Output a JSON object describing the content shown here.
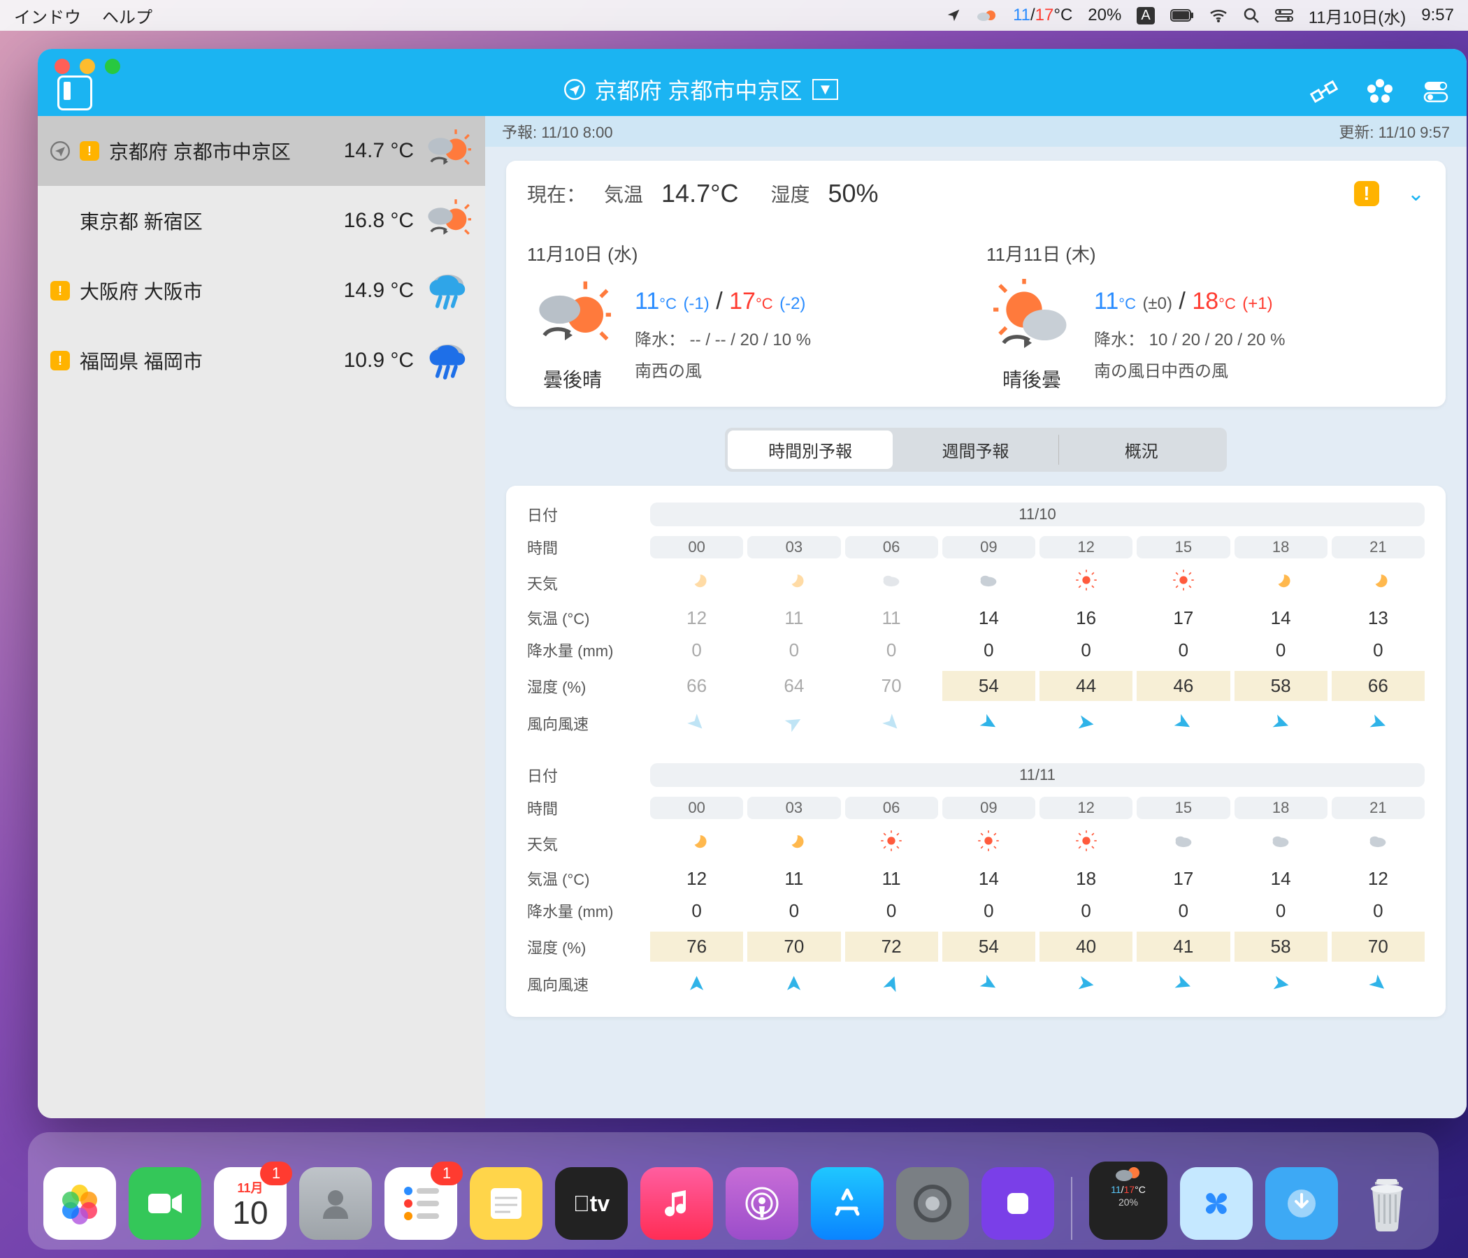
{
  "menubar": {
    "menus": [
      "インドウ",
      "ヘルプ"
    ],
    "temp_low": "11",
    "temp_high": "17",
    "temp_unit": "°C",
    "battery_pct": "20%",
    "ime": "A",
    "date": "11月10日(水)",
    "time": "9:57"
  },
  "titlebar": {
    "location": "京都府 京都市中京区"
  },
  "infobar": {
    "forecast": "予報: 11/10 8:00",
    "updated": "更新: 11/10 9:57"
  },
  "current": {
    "label_now": "現在：",
    "label_temp": "気温",
    "temp": "14.7°C",
    "label_hum": "湿度",
    "hum": "50%"
  },
  "sidebar": [
    {
      "name": "京都府 京都市中京区",
      "temp": "14.7 °C",
      "sel": true,
      "loc": true,
      "warn": true,
      "icon": "cloudy-then-sun"
    },
    {
      "name": "東京都 新宿区",
      "temp": "16.8 °C",
      "icon": "cloudy-then-sun"
    },
    {
      "name": "大阪府 大阪市",
      "temp": "14.9 °C",
      "warn": true,
      "icon": "rain"
    },
    {
      "name": "福岡県 福岡市",
      "temp": "10.9 °C",
      "warn": true,
      "icon": "rain-heavy"
    }
  ],
  "days": [
    {
      "header": "11月10日 (水)",
      "caption": "曇後晴",
      "low": "11",
      "low_d": "(-1)",
      "high": "17",
      "high_d": "(-2)",
      "precip": "降水：  -- / -- / 20 / 10 %",
      "wind": "南西の風",
      "icon": "cloudy-then-sun"
    },
    {
      "header": "11月11日 (木)",
      "caption": "晴後曇",
      "low": "11",
      "low_d": "(±0)",
      "high": "18",
      "high_d": "(+1)",
      "precip": "降水：  10 / 20 / 20 / 20 %",
      "wind": "南の風日中西の風",
      "icon": "sun-then-cloudy"
    }
  ],
  "seg": {
    "hourly": "時間別予報",
    "weekly": "週間予報",
    "overview": "概況"
  },
  "hourly_labels": {
    "date": "日付",
    "time": "時間",
    "weather": "天気",
    "temp": "気温 (°C)",
    "precip": "降水量 (mm)",
    "hum": "湿度 (%)",
    "wind": "風向風速"
  },
  "hourly": [
    {
      "date": "11/10",
      "hours": [
        "00",
        "03",
        "06",
        "09",
        "12",
        "15",
        "18",
        "21"
      ],
      "weather": [
        "moon",
        "moon",
        "cloud",
        "cloud",
        "sun",
        "sun",
        "moon",
        "moon"
      ],
      "past": [
        true,
        true,
        true,
        false,
        false,
        false,
        false,
        false
      ],
      "temp": [
        "12",
        "11",
        "11",
        "14",
        "16",
        "17",
        "14",
        "13"
      ],
      "precip": [
        "0",
        "0",
        "0",
        "0",
        "0",
        "0",
        "0",
        "0"
      ],
      "hum": [
        "66",
        "64",
        "70",
        "54",
        "44",
        "46",
        "58",
        "66"
      ],
      "wind_dir": [
        45,
        -30,
        45,
        30,
        10,
        30,
        20,
        20
      ]
    },
    {
      "date": "11/11",
      "hours": [
        "00",
        "03",
        "06",
        "09",
        "12",
        "15",
        "18",
        "21"
      ],
      "weather": [
        "moon",
        "moon",
        "sun",
        "sun",
        "sun",
        "cloud",
        "cloud",
        "cloud"
      ],
      "past": [
        false,
        false,
        false,
        false,
        false,
        false,
        false,
        false
      ],
      "temp": [
        "12",
        "11",
        "11",
        "14",
        "18",
        "17",
        "14",
        "12"
      ],
      "precip": [
        "0",
        "0",
        "0",
        "0",
        "0",
        "0",
        "0",
        "0"
      ],
      "hum": [
        "76",
        "70",
        "72",
        "54",
        "40",
        "41",
        "58",
        "70"
      ],
      "wind_dir": [
        -90,
        -90,
        -70,
        30,
        10,
        20,
        10,
        40
      ]
    }
  ],
  "dock": {
    "cal_month": "11月",
    "cal_day": "10",
    "cal_badge": "1",
    "rem_badge": "1"
  }
}
